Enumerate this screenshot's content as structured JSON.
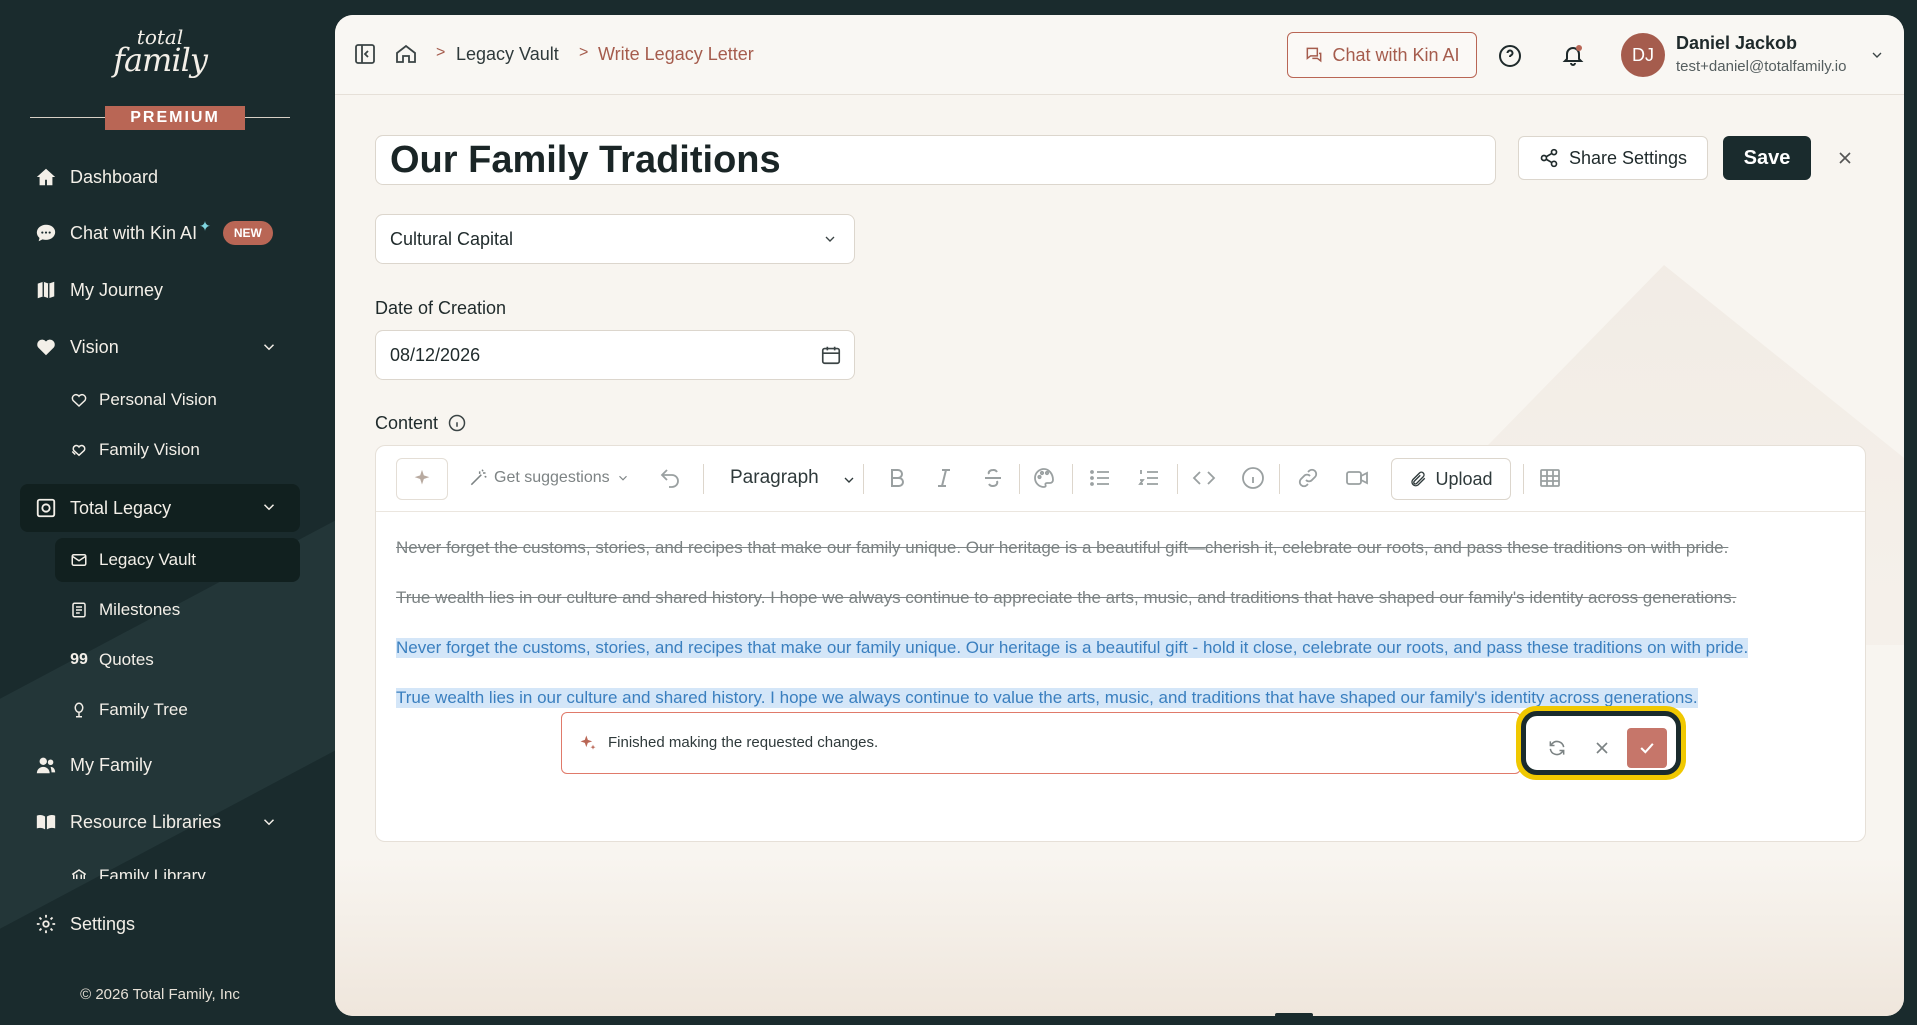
{
  "brand": {
    "logo_line1": "total",
    "logo_line2": "family",
    "tier": "PREMIUM",
    "copyright": "© 2026 Total Family, Inc"
  },
  "sidebar": {
    "items": [
      {
        "label": "Dashboard",
        "icon": "home-icon"
      },
      {
        "label": "Chat with Kin AI",
        "icon": "chat-bubble-icon",
        "badge": "NEW"
      },
      {
        "label": "My Journey",
        "icon": "map-icon"
      },
      {
        "label": "Vision",
        "icon": "heart-icon"
      },
      {
        "label": "Personal Vision",
        "icon": "heart-outline-icon"
      },
      {
        "label": "Family Vision",
        "icon": "heart-hands-icon"
      },
      {
        "label": "Total Legacy",
        "icon": "vault-icon"
      },
      {
        "label": "Legacy Vault",
        "icon": "envelope-icon"
      },
      {
        "label": "Milestones",
        "icon": "document-icon"
      },
      {
        "label": "Quotes",
        "icon": "quote-icon"
      },
      {
        "label": "Family Tree",
        "icon": "tree-icon"
      },
      {
        "label": "My Family",
        "icon": "users-icon"
      },
      {
        "label": "Resource Libraries",
        "icon": "book-icon"
      },
      {
        "label": "Family Library",
        "icon": "library-icon"
      },
      {
        "label": "Settings",
        "icon": "gear-icon"
      }
    ]
  },
  "topbar": {
    "breadcrumbs": [
      "Legacy Vault",
      "Write Legacy Letter"
    ],
    "chat_button": "Chat with Kin AI",
    "user": {
      "initials": "DJ",
      "name": "Daniel Jackob",
      "email": "test+daniel@totalfamily.io"
    }
  },
  "editor_page": {
    "title": "Our Family Traditions",
    "share_button": "Share Settings",
    "save_button": "Save",
    "category": "Cultural Capital",
    "date_label": "Date of Creation",
    "date_value": "08/12/2026",
    "content_label": "Content",
    "toolbar": {
      "suggestions": "Get suggestions",
      "block_type": "Paragraph",
      "upload": "Upload"
    },
    "lines_removed": [
      "Never forget the customs, stories, and recipes that make our family unique. Our heritage is a beautiful gift—cherish it, celebrate our roots, and pass these traditions on with pride.",
      "True wealth lies in our culture and shared history. I hope we always continue to appreciate the arts, music, and traditions that have shaped our family's identity across generations."
    ],
    "lines_added": [
      "Never forget the customs, stories, and recipes that make our family unique. Our heritage is a beautiful gift - hold it close, celebrate our roots, and pass these traditions on with pride.",
      "True wealth lies in our culture and shared history. I hope we always continue to value the arts, music, and traditions that have shaped our family's identity across generations."
    ],
    "ai_message": "Finished making the requested changes."
  },
  "colors": {
    "sidebar_bg": "#1a2b2d",
    "accent": "#b96655",
    "highlight_focus": "#f0c800"
  }
}
